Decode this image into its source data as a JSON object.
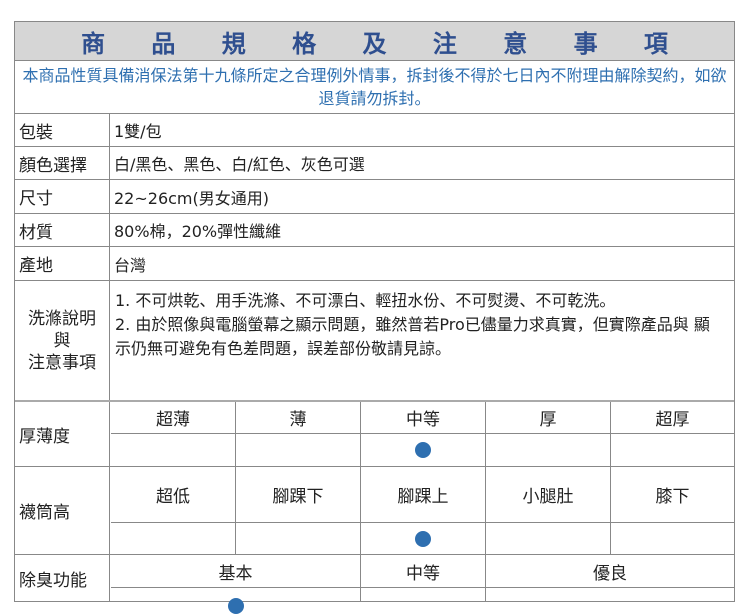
{
  "title": "商 品 規 格 及 注 意 事 項",
  "notice": "本商品性質具備消保法第十九條所定之合理例外情事，拆封後不得於七日內不附理由解除契約，如欲退貨請勿拆封。",
  "specs": [
    {
      "label": "包裝",
      "value": "1雙/包"
    },
    {
      "label": "顏色選擇",
      "value": "白/黑色、黑色、白/紅色、灰色可選"
    },
    {
      "label": "尺寸",
      "value": "22~26cm(男女通用)"
    },
    {
      "label": "材質",
      "value": "80%棉，20%彈性纖維"
    },
    {
      "label": "產地",
      "value": "台灣"
    }
  ],
  "care": {
    "label_line1": "洗滌說明",
    "label_line2": "與",
    "label_line3": "注意事項",
    "line1": "1. 不可烘乾、用手洗滌、不可漂白、輕扭水份、不可熨燙、不可乾洗。",
    "line2": "2. 由於照像與電腦螢幕之顯示問題，雖然普若Pro已儘量力求真實，但實際產品與 顯示仍無可避免有色差問題，誤差部份敬請見諒。"
  },
  "thickness": {
    "label": "厚薄度",
    "options": [
      "超薄",
      "薄",
      "中等",
      "厚",
      "超厚"
    ],
    "selected_index": 2
  },
  "sock_height": {
    "label": "襪筒高",
    "options": [
      "超低",
      "腳踝下",
      "腳踝上",
      "小腿肚",
      "膝下"
    ],
    "selected_index": 2
  },
  "deodorant": {
    "label": "除臭功能",
    "options": [
      "基本",
      "中等",
      "優良"
    ],
    "selected_index": 0
  },
  "colors": {
    "title_text": "#2f4f8f",
    "notice_text": "#2e6fb0",
    "dot": "#2e6fb0",
    "title_bg": "#d6d6d6"
  }
}
